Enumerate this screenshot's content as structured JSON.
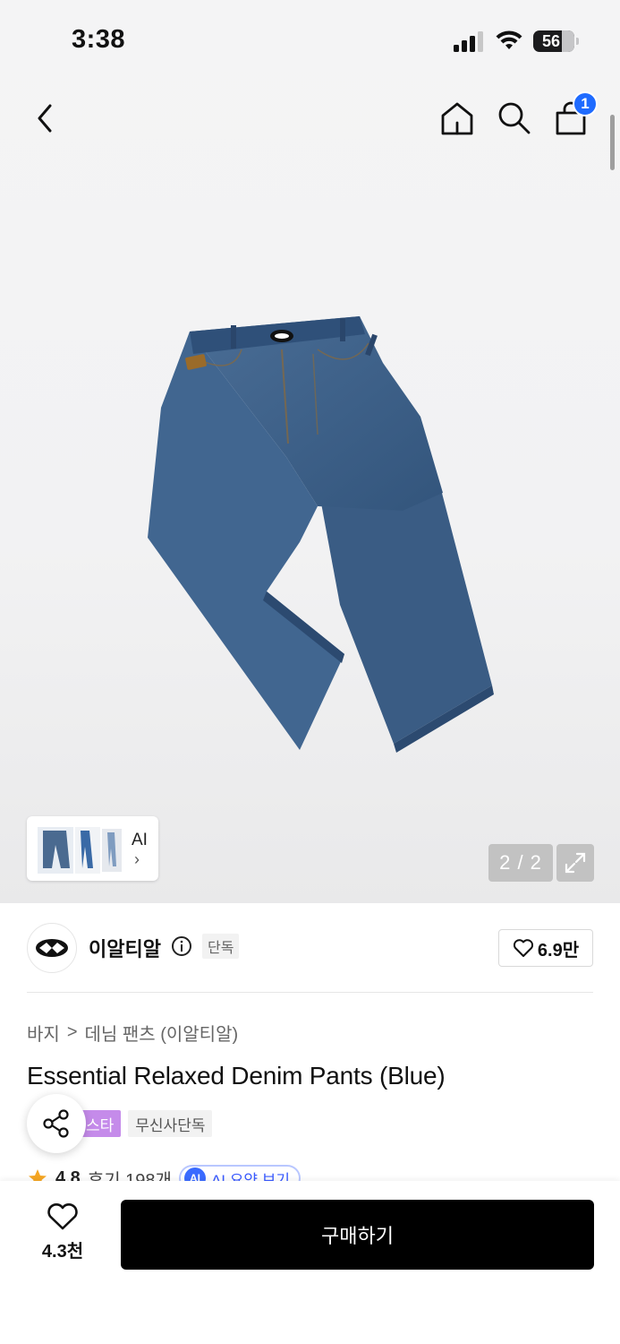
{
  "status_bar": {
    "time": "3:38",
    "battery": "56"
  },
  "header": {
    "cart_count": "1"
  },
  "gallery": {
    "thumb_label": "AI",
    "page_counter": "2 / 2"
  },
  "brand": {
    "name": "이알티알",
    "exclusive_tag": "단독",
    "likes": "6.9만"
  },
  "product": {
    "breadcrumb": [
      "바지",
      "데님 팬츠 (이알티알)"
    ],
    "title": "Essential Relaxed Denim Pants (Blue)",
    "tags": [
      "스타",
      "무신사단독"
    ],
    "rating": "4.8",
    "review_count": "후기 198개",
    "ai_summary_badge": "AI",
    "ai_summary_label": "AI 요약 보기"
  },
  "bottom_bar": {
    "like_count": "4.3천",
    "buy_label": "구매하기"
  },
  "colors": {
    "accent_blue": "#1f6bff",
    "tag_purple": "#c58bea",
    "buy_button": "#000000",
    "denim": "#3d5f86"
  }
}
